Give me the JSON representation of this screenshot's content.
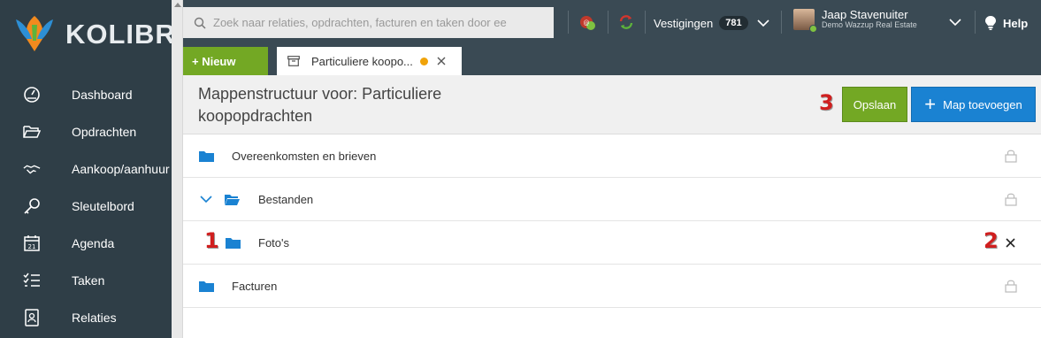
{
  "app": {
    "name": "KOLIBRI"
  },
  "sidebar": {
    "items": [
      {
        "label": "Dashboard",
        "icon": "dashboard-icon"
      },
      {
        "label": "Opdrachten",
        "icon": "folder-open-icon"
      },
      {
        "label": "Aankoop/aanhuur",
        "icon": "handshake-icon"
      },
      {
        "label": "Sleutelbord",
        "icon": "key-icon"
      },
      {
        "label": "Agenda",
        "icon": "calendar-icon"
      },
      {
        "label": "Taken",
        "icon": "tasks-icon"
      },
      {
        "label": "Relaties",
        "icon": "contacts-icon"
      }
    ]
  },
  "topbar": {
    "search_placeholder": "Zoek naar relaties, opdrachten, facturen en taken door ee",
    "vestigingen_label": "Vestigingen",
    "vestigingen_count": "781",
    "user_name": "Jaap Stavenuiter",
    "user_company": "Demo Wazzup Real Estate",
    "help_label": "Help"
  },
  "tabs": {
    "new_label": "+ Nieuw",
    "active_tab_label": "Particuliere koopo..."
  },
  "main": {
    "title": "Mappenstructuur voor: Particuliere koopopdrachten",
    "save_label": "Opslaan",
    "add_label": "Map toevoegen",
    "annotations": {
      "one": "1",
      "two": "2",
      "three": "3"
    },
    "folders": [
      {
        "label": "Overeenkomsten en brieven",
        "locked": true
      },
      {
        "label": "Bestanden",
        "locked": true,
        "expanded": true
      },
      {
        "label": "Foto's",
        "locked": false
      },
      {
        "label": "Facturen",
        "locked": true
      }
    ]
  },
  "colors": {
    "sidebar_bg": "#2f3e47",
    "topbar_bg": "#3a4a54",
    "green": "#73a824",
    "blue": "#1a82d2",
    "folder_blue": "#1a82d2",
    "unsaved_dot": "#f0a30a"
  }
}
